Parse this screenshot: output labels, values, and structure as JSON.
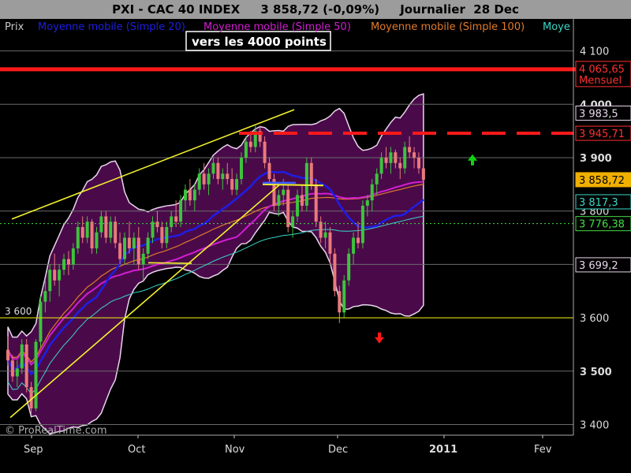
{
  "header": {
    "title": "PXI - CAC 40 INDEX",
    "quote": "3 858,72 (-0,09%)",
    "period": "Journalier",
    "date": "28 Dec"
  },
  "legend": [
    {
      "label": "Prix",
      "color": "#c8c8c8"
    },
    {
      "label": "Moyenne mobile (Simple 20)",
      "color": "#1e1ee6"
    },
    {
      "label": "Moyenne mobile (Simple 50)",
      "color": "#d21ed2"
    },
    {
      "label": "Moyenne mobile (Simple 100)",
      "color": "#e07a2a"
    },
    {
      "label": "Moye",
      "color": "#3ad6c8"
    }
  ],
  "annotation": "vers les 4000 points",
  "watermark": "© ProRealTime.com",
  "colors": {
    "background": "#000000",
    "bollinger_fill": "#4a0a4a",
    "bollinger_edge": "#e8d6ec",
    "up_candle": "#3cc43c",
    "down_candle": "#e87a7a",
    "trendline": "#f2f22c",
    "resistance": "#ff1a1a",
    "support": "#e6e600",
    "arrow_up": "#11d411",
    "arrow_down": "#ff1a1a"
  },
  "chart_data": {
    "type": "candlestick",
    "y_axis": {
      "min": 3380,
      "max": 4160,
      "ticks": [
        3400,
        3500,
        3600,
        3700,
        3800,
        3900,
        4000,
        4100
      ],
      "tick_labels": [
        "3 400",
        "3 500",
        "3 600",
        "3 700",
        "3 800",
        "3 900",
        "4 000",
        "4 100"
      ]
    },
    "x_axis": {
      "labels": [
        "Sep",
        "Oct",
        "Nov",
        "Dec",
        "2011",
        "Fev"
      ]
    },
    "price_labels": [
      {
        "text": "4 065,65",
        "subtext": "Mensuel",
        "value": 4065.65,
        "bg": "#000000",
        "fg": "#ff3030",
        "border": "#ff3030"
      },
      {
        "text": "3 983,5",
        "value": 3983.5,
        "bg": "#000000",
        "fg": "#e8d6ec",
        "border": "#e8d6ec"
      },
      {
        "text": "3 945,71",
        "value": 3945.71,
        "bg": "#000000",
        "fg": "#ff3030",
        "border": "#ff3030"
      },
      {
        "text": "3 858,72",
        "value": 3858.72,
        "bg": "#f0b000",
        "fg": "#000000",
        "border": "#f0b000"
      },
      {
        "text": "3 817,3",
        "value": 3817.3,
        "bg": "#000000",
        "fg": "#3ad6c8",
        "border": "#3ad6c8"
      },
      {
        "text": "3 776,38",
        "value": 3776.38,
        "bg": "#000000",
        "fg": "#44dd44",
        "border": "#44dd44"
      },
      {
        "text": "3 699,2",
        "value": 3699.2,
        "bg": "#000000",
        "fg": "#e8d6ec",
        "border": "#e8d6ec"
      }
    ],
    "levels": [
      {
        "name": "mensuel",
        "value": 4065.65,
        "style": "solid"
      },
      {
        "name": "resistance",
        "value": 3945.71,
        "style": "dashed"
      },
      {
        "name": "3600",
        "value": 3600,
        "style": "solid",
        "label": "3 600"
      },
      {
        "name": "3776",
        "value": 3776.38,
        "style": "dotted"
      }
    ],
    "candles": [
      [
        3540,
        3565,
        3510,
        3520
      ],
      [
        3520,
        3530,
        3480,
        3490
      ],
      [
        3490,
        3520,
        3470,
        3505
      ],
      [
        3505,
        3560,
        3495,
        3550
      ],
      [
        3550,
        3560,
        3460,
        3470
      ],
      [
        3470,
        3480,
        3420,
        3430
      ],
      [
        3430,
        3560,
        3425,
        3555
      ],
      [
        3555,
        3640,
        3545,
        3630
      ],
      [
        3630,
        3670,
        3610,
        3650
      ],
      [
        3650,
        3700,
        3630,
        3690
      ],
      [
        3690,
        3720,
        3660,
        3670
      ],
      [
        3670,
        3700,
        3640,
        3690
      ],
      [
        3690,
        3720,
        3680,
        3710
      ],
      [
        3710,
        3725,
        3680,
        3700
      ],
      [
        3700,
        3740,
        3690,
        3730
      ],
      [
        3730,
        3780,
        3720,
        3770
      ],
      [
        3770,
        3790,
        3740,
        3750
      ],
      [
        3750,
        3790,
        3740,
        3780
      ],
      [
        3780,
        3785,
        3720,
        3730
      ],
      [
        3730,
        3770,
        3720,
        3760
      ],
      [
        3760,
        3800,
        3750,
        3790
      ],
      [
        3790,
        3800,
        3740,
        3750
      ],
      [
        3750,
        3790,
        3740,
        3780
      ],
      [
        3780,
        3790,
        3730,
        3740
      ],
      [
        3740,
        3760,
        3700,
        3710
      ],
      [
        3710,
        3760,
        3700,
        3750
      ],
      [
        3750,
        3780,
        3720,
        3730
      ],
      [
        3730,
        3760,
        3700,
        3750
      ],
      [
        3750,
        3770,
        3690,
        3700
      ],
      [
        3700,
        3730,
        3670,
        3720
      ],
      [
        3720,
        3760,
        3710,
        3750
      ],
      [
        3750,
        3790,
        3740,
        3780
      ],
      [
        3780,
        3800,
        3760,
        3770
      ],
      [
        3770,
        3780,
        3730,
        3740
      ],
      [
        3740,
        3780,
        3730,
        3770
      ],
      [
        3770,
        3800,
        3760,
        3790
      ],
      [
        3790,
        3820,
        3770,
        3780
      ],
      [
        3780,
        3830,
        3770,
        3820
      ],
      [
        3820,
        3850,
        3800,
        3840
      ],
      [
        3840,
        3860,
        3810,
        3820
      ],
      [
        3820,
        3850,
        3800,
        3840
      ],
      [
        3840,
        3880,
        3830,
        3870
      ],
      [
        3870,
        3890,
        3840,
        3850
      ],
      [
        3850,
        3880,
        3830,
        3870
      ],
      [
        3870,
        3900,
        3860,
        3890
      ],
      [
        3890,
        3900,
        3850,
        3860
      ],
      [
        3860,
        3880,
        3840,
        3870
      ],
      [
        3870,
        3890,
        3850,
        3860
      ],
      [
        3860,
        3880,
        3830,
        3840
      ],
      [
        3840,
        3870,
        3830,
        3860
      ],
      [
        3860,
        3910,
        3850,
        3900
      ],
      [
        3900,
        3940,
        3890,
        3930
      ],
      [
        3930,
        3950,
        3910,
        3920
      ],
      [
        3920,
        3960,
        3910,
        3950
      ],
      [
        3950,
        3960,
        3920,
        3930
      ],
      [
        3930,
        3940,
        3880,
        3890
      ],
      [
        3890,
        3900,
        3850,
        3860
      ],
      [
        3860,
        3870,
        3800,
        3810
      ],
      [
        3810,
        3840,
        3790,
        3830
      ],
      [
        3830,
        3860,
        3810,
        3840
      ],
      [
        3840,
        3850,
        3760,
        3770
      ],
      [
        3770,
        3800,
        3750,
        3790
      ],
      [
        3790,
        3840,
        3780,
        3830
      ],
      [
        3830,
        3850,
        3800,
        3810
      ],
      [
        3810,
        3900,
        3800,
        3890
      ],
      [
        3890,
        3900,
        3840,
        3850
      ],
      [
        3850,
        3860,
        3770,
        3780
      ],
      [
        3780,
        3790,
        3740,
        3750
      ],
      [
        3750,
        3780,
        3730,
        3760
      ],
      [
        3760,
        3770,
        3700,
        3720
      ],
      [
        3720,
        3730,
        3640,
        3650
      ],
      [
        3650,
        3660,
        3590,
        3610
      ],
      [
        3610,
        3680,
        3600,
        3670
      ],
      [
        3670,
        3730,
        3660,
        3720
      ],
      [
        3720,
        3760,
        3700,
        3750
      ],
      [
        3750,
        3780,
        3730,
        3740
      ],
      [
        3740,
        3820,
        3730,
        3810
      ],
      [
        3810,
        3830,
        3790,
        3820
      ],
      [
        3820,
        3860,
        3800,
        3850
      ],
      [
        3850,
        3880,
        3830,
        3870
      ],
      [
        3870,
        3910,
        3860,
        3900
      ],
      [
        3900,
        3920,
        3880,
        3890
      ],
      [
        3890,
        3920,
        3870,
        3910
      ],
      [
        3910,
        3915,
        3880,
        3890
      ],
      [
        3890,
        3900,
        3860,
        3880
      ],
      [
        3880,
        3930,
        3870,
        3920
      ],
      [
        3920,
        3940,
        3900,
        3910
      ],
      [
        3910,
        3920,
        3880,
        3900
      ],
      [
        3900,
        3910,
        3870,
        3880
      ],
      [
        3880,
        3900,
        3850,
        3858.72
      ]
    ]
  }
}
